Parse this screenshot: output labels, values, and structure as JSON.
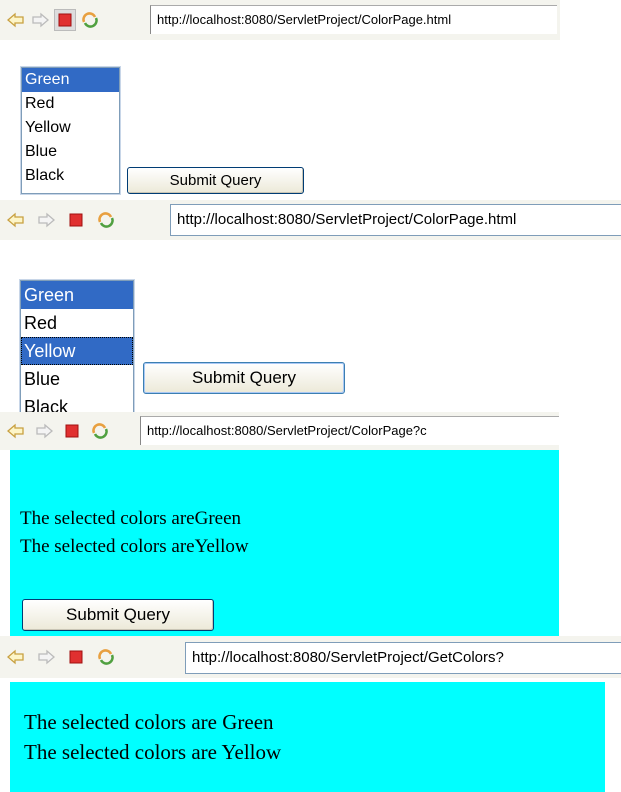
{
  "frames": [
    {
      "url": "http://localhost:8080/ServletProject/ColorPage.html",
      "options": [
        "Green",
        "Red",
        "Yellow",
        "Blue",
        "Black"
      ],
      "selected": [
        "Green"
      ],
      "submit_label": "Submit Query"
    },
    {
      "url": "http://localhost:8080/ServletProject/ColorPage.html",
      "options": [
        "Green",
        "Red",
        "Yellow",
        "Blue",
        "Black"
      ],
      "selected": [
        "Green",
        "Yellow"
      ],
      "submit_label": "Submit Query"
    },
    {
      "url": "http://localhost:8080/ServletProject/ColorPage?c",
      "lines": [
        "The selected colors areGreen",
        "The selected colors areYellow"
      ],
      "submit_label": "Submit Query"
    },
    {
      "url": "http://localhost:8080/ServletProject/GetColors?",
      "lines": [
        "The selected colors are Green",
        "The selected colors are Yellow"
      ]
    }
  ],
  "colors": {
    "result_bg": "#00ffff",
    "selection": "#316ac5"
  },
  "icons": [
    "back-arrow-icon",
    "forward-arrow-icon",
    "stop-icon",
    "refresh-icon"
  ]
}
